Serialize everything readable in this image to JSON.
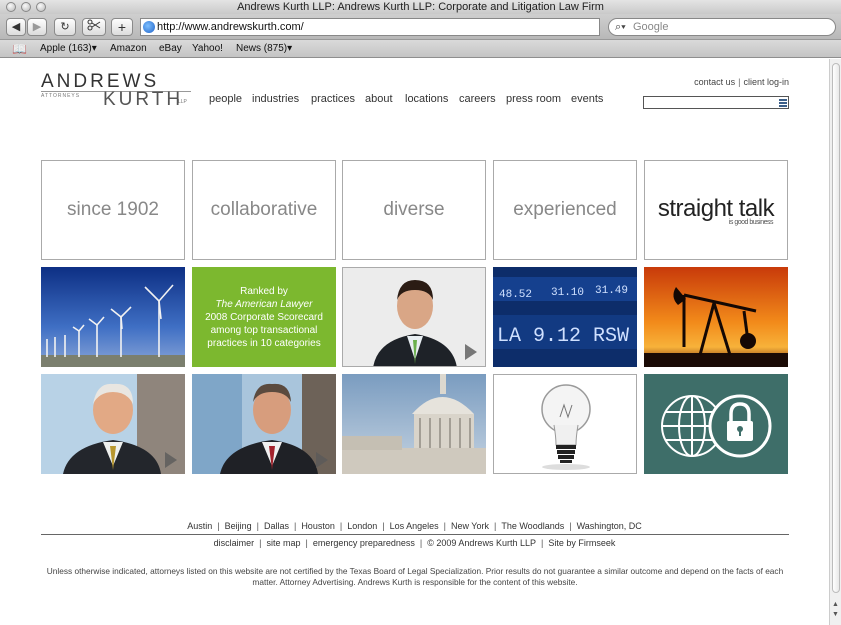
{
  "window": {
    "title": "Andrews Kurth LLP: Andrews Kurth LLP: Corporate and Litigation Law Firm"
  },
  "browser": {
    "back": "◀",
    "forward": "▶",
    "reload": "↻",
    "add": "+",
    "url": "http://www.andrewskurth.com/",
    "search_placeholder": "Google",
    "bookmarks": [
      "Apple (163)▾",
      "Amazon",
      "eBay",
      "Yahoo!",
      "News (875)▾"
    ]
  },
  "header": {
    "logo_top": "ANDREWS",
    "logo_attorneys": "ATTORNEYS",
    "logo_bottom": "KURTH",
    "logo_llp": "LLP",
    "nav": [
      "people",
      "industries",
      "practices",
      "about",
      "locations",
      "careers",
      "press room",
      "events"
    ],
    "contact": "contact us",
    "login": "client log-in"
  },
  "tiles_row1": [
    "since 1902",
    "collaborative",
    "diverse",
    "experienced"
  ],
  "straight_talk": {
    "title": "straight talk",
    "sub": "is good business"
  },
  "green_tile": {
    "line1": "Ranked by",
    "line2": "The American Lawyer",
    "line3": "2008 Corporate Scorecard",
    "line4": "among top transactional",
    "line5": "practices in 10 categories"
  },
  "ticker": {
    "top": [
      "48.52",
      "31.10",
      "31.49"
    ],
    "bottom": "LA  9.12  RSW"
  },
  "footer": {
    "cities": [
      "Austin",
      "Beijing",
      "Dallas",
      "Houston",
      "London",
      "Los Angeles",
      "New York",
      "The Woodlands",
      "Washington, DC"
    ],
    "links": [
      "disclaimer",
      "site map",
      "emergency preparedness",
      "© 2009 Andrews Kurth LLP",
      "Site by Firmseek"
    ],
    "disclaimer": "Unless otherwise indicated, attorneys listed on this website are not certified by the Texas Board of Legal Specialization. Prior results do not guarantee a similar outcome and depend on the facts of each matter. Attorney Advertising. Andrews Kurth is responsible for the content of this website."
  },
  "colors": {
    "green": "#7cb82f",
    "teal": "#3e6e69"
  }
}
